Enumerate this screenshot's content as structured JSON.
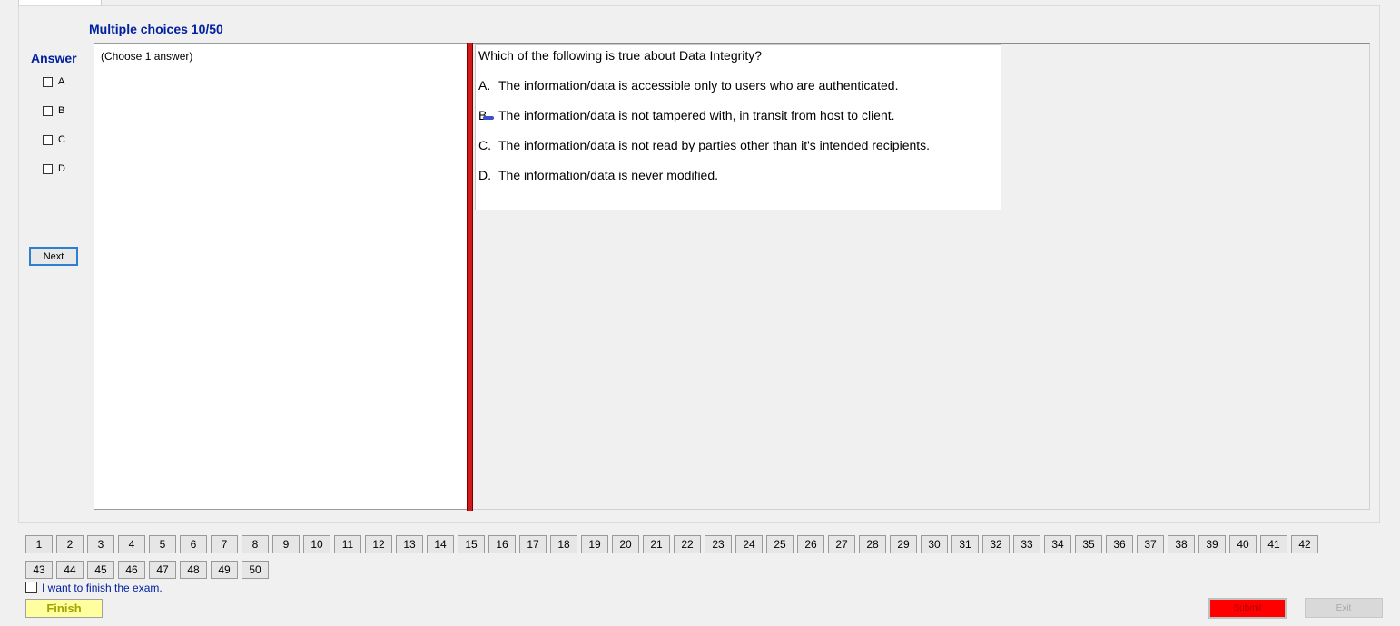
{
  "header": {
    "title": "Multiple choices 10/50"
  },
  "answer": {
    "label": "Answer",
    "options": [
      "A",
      "B",
      "C",
      "D"
    ],
    "next_label": "Next"
  },
  "left_panel": {
    "hint": "(Choose 1 answer)"
  },
  "question": {
    "text": "Which of the following is true about Data Integrity?",
    "choices": [
      {
        "letter": "A.",
        "text": "The information/data is accessible only to users who are authenticated."
      },
      {
        "letter": "B.",
        "text": "The information/data is not tampered with, in transit from host to client."
      },
      {
        "letter": "C.",
        "text": "The information/data is not read by parties other than it's intended recipients."
      },
      {
        "letter": "D.",
        "text": "The information/data is never modified."
      }
    ]
  },
  "nav": {
    "row1": [
      "1",
      "2",
      "3",
      "4",
      "5",
      "6",
      "7",
      "8",
      "9",
      "10",
      "11",
      "12",
      "13",
      "14",
      "15",
      "16",
      "17",
      "18",
      "19",
      "20",
      "21",
      "22",
      "23",
      "24",
      "25",
      "26",
      "27",
      "28",
      "29",
      "30",
      "31",
      "32",
      "33",
      "34",
      "35",
      "36",
      "37",
      "38",
      "39",
      "40",
      "41",
      "42"
    ],
    "row2": [
      "43",
      "44",
      "45",
      "46",
      "47",
      "48",
      "49",
      "50"
    ]
  },
  "footer": {
    "finish_checkbox_label": "I want to finish the exam.",
    "finish_label": "Finish",
    "submit_label": "Submit",
    "exit_label": "Exit"
  },
  "colors": {
    "accent": "#00209f",
    "splitter": "#d11a1a",
    "submit": "#ff0000",
    "finish": "#ffffa0"
  }
}
